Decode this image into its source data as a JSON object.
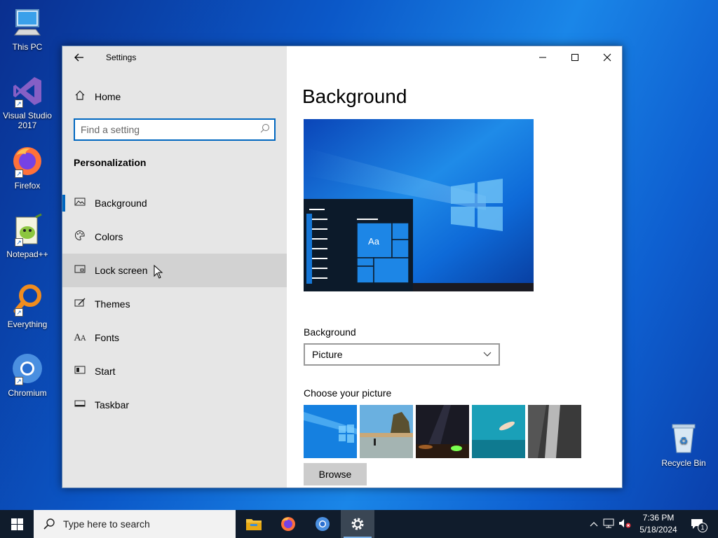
{
  "desktop": {
    "icons": [
      {
        "label": "This PC"
      },
      {
        "label": "Visual Studio 2017"
      },
      {
        "label": "Firefox"
      },
      {
        "label": "Notepad++"
      },
      {
        "label": "Everything"
      },
      {
        "label": "Chromium"
      },
      {
        "label": "Recycle Bin"
      }
    ]
  },
  "window": {
    "title": "Settings",
    "sidebar": {
      "home_label": "Home",
      "search_placeholder": "Find a setting",
      "section_title": "Personalization",
      "items": [
        {
          "label": "Background",
          "icon": "picture-icon"
        },
        {
          "label": "Colors",
          "icon": "palette-icon"
        },
        {
          "label": "Lock screen",
          "icon": "lock-screen-icon"
        },
        {
          "label": "Themes",
          "icon": "themes-icon"
        },
        {
          "label": "Fonts",
          "icon": "fonts-icon"
        },
        {
          "label": "Start",
          "icon": "start-icon"
        },
        {
          "label": "Taskbar",
          "icon": "taskbar-icon"
        }
      ],
      "active_item": "Background",
      "hovered_item": "Lock screen"
    },
    "content": {
      "page_title": "Background",
      "preview_tile_text": "Aa",
      "background_label": "Background",
      "background_value": "Picture",
      "choose_label": "Choose your picture",
      "browse_label": "Browse"
    }
  },
  "taskbar": {
    "search_placeholder": "Type here to search",
    "apps": [
      "file-explorer",
      "firefox",
      "chromium",
      "settings"
    ],
    "clock_time": "7:36 PM",
    "clock_date": "5/18/2024",
    "notification_count": "1"
  },
  "colors": {
    "accent": "#0067c0",
    "sidebar_bg": "#e6e6e6",
    "taskbar_bg": "#101c2c"
  }
}
